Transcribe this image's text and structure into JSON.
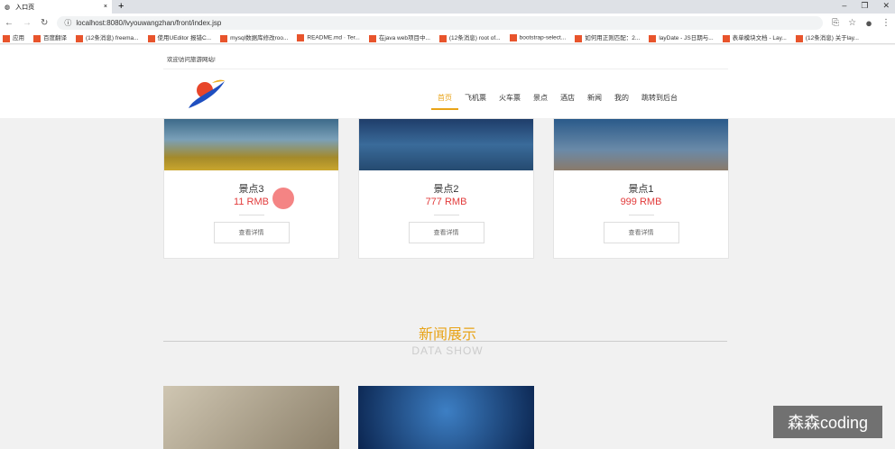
{
  "browser": {
    "tab_title": "入口页",
    "url": "localhost:8080/lvyouwangzhan/front/index.jsp",
    "bookmarks": [
      "应用",
      "百度翻译",
      "(12条消息) freema...",
      "使用UEditor 报错C...",
      "mysql数据库修改roo...",
      "README.md · Ter...",
      "在java web项目中...",
      "(12条消息) root of...",
      "bootstrap-select...",
      "如何用正则匹配：2...",
      "layDate - JS日期与...",
      "表单模块文档 - Lay...",
      "(12条消息) 关于lay..."
    ]
  },
  "header": {
    "welcome": "欢迎访问旅游网站!",
    "nav": [
      "首页",
      "飞机票",
      "火车票",
      "景点",
      "酒店",
      "新闻",
      "我的",
      "跳转到后台"
    ],
    "active_nav": "首页"
  },
  "spots": [
    {
      "name": "景点3",
      "price": "11 RMB",
      "button": "查看详情"
    },
    {
      "name": "景点2",
      "price": "777 RMB",
      "button": "查看详情"
    },
    {
      "name": "景点1",
      "price": "999 RMB",
      "button": "查看详情"
    }
  ],
  "news_section": {
    "title": "新闻展示",
    "subtitle": "DATA SHOW"
  },
  "watermark": "森森coding",
  "colors": {
    "accent": "#e8a317",
    "price": "#e23b3b"
  }
}
